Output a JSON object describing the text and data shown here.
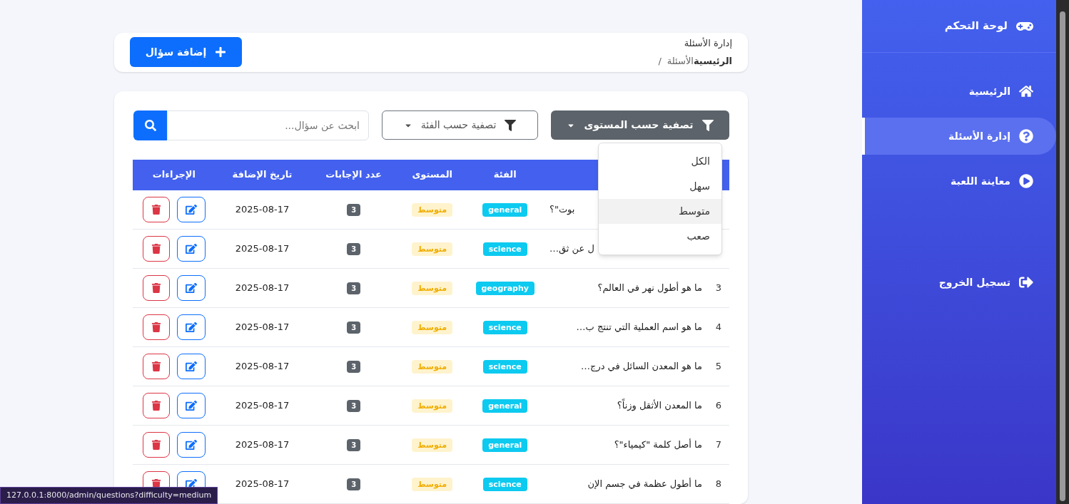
{
  "sidebar": {
    "brand": "لوحة التحكم",
    "items": [
      {
        "label": "الرئيسية",
        "selected": false
      },
      {
        "label": "إدارة الأسئلة",
        "selected": true
      },
      {
        "label": "معاينة اللعبة",
        "selected": false
      }
    ],
    "logout": "تسجيل الخروج"
  },
  "header": {
    "title": "إدارة الأسئلة",
    "breadcrumb": {
      "home": "الرئيسية",
      "current": "الأسئلة",
      "separator": "/"
    },
    "add_button": "إضافة سؤال"
  },
  "filters": {
    "level_filter": {
      "label": "تصفية حسب المستوى",
      "expanded": true,
      "options": [
        {
          "label": "الكل",
          "selected": false
        },
        {
          "label": "سهل",
          "selected": false
        },
        {
          "label": "متوسط",
          "selected": true
        },
        {
          "label": "صعب",
          "selected": false
        }
      ]
    },
    "category_filter": {
      "label": "تصفية حسب الفئة"
    },
    "search": {
      "placeholder": "ابحث عن سؤال..."
    }
  },
  "table": {
    "columns": [
      "الفئة",
      "المستوى",
      "عدد الإجابات",
      "تاريخ الإضافة",
      "الإجراءات"
    ],
    "rows": [
      {
        "question": "بوت\"؟",
        "category": "general",
        "level": "متوسط",
        "answers": "3",
        "date": "2025-08-17"
      },
      {
        "question": "ل عن ثق…",
        "category": "science",
        "level": "متوسط",
        "answers": "3",
        "date": "2025-08-17"
      },
      {
        "num": "3",
        "question": "ما هو أطول نهر في العالم؟",
        "category": "geography",
        "level": "متوسط",
        "answers": "3",
        "date": "2025-08-17"
      },
      {
        "num": "4",
        "question": "ما هو اسم العملية التي تنتج ب…",
        "category": "science",
        "level": "متوسط",
        "answers": "3",
        "date": "2025-08-17"
      },
      {
        "num": "5",
        "question": "ما هو المعدن السائل في درج…",
        "category": "science",
        "level": "متوسط",
        "answers": "3",
        "date": "2025-08-17"
      },
      {
        "num": "6",
        "question": "ما المعدن الأثقل وزناً؟",
        "category": "general",
        "level": "متوسط",
        "answers": "3",
        "date": "2025-08-17"
      },
      {
        "num": "7",
        "question": "ما أصل كلمة \"كيمياء\"؟",
        "category": "general",
        "level": "متوسط",
        "answers": "3",
        "date": "2025-08-17"
      },
      {
        "num": "8",
        "question": "ما أطول عظمة في جسم الإن",
        "category": "science",
        "level": "متوسط",
        "answers": "3",
        "date": "2025-08-17"
      }
    ]
  },
  "status_url": "127.0.0.1:8000/admin/questions?difficulty=medium"
}
